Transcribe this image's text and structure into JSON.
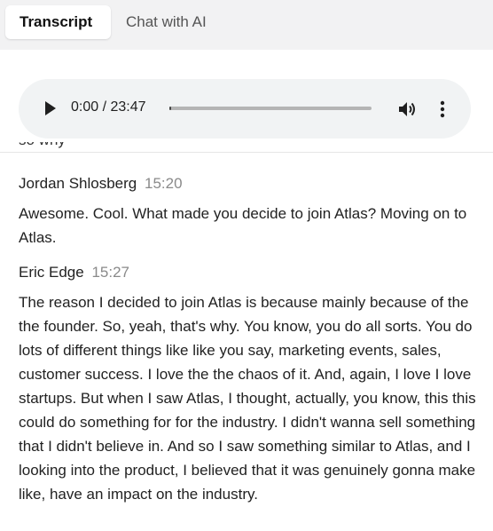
{
  "tabs": [
    {
      "label": "Transcript",
      "active": true
    },
    {
      "label": "Chat with AI",
      "active": false
    }
  ],
  "player": {
    "time_display": "0:00 / 23:47",
    "progress_fraction": 0.0,
    "play_icon": "play-icon",
    "volume_icon": "volume-icon",
    "more_icon": "more-vertical-icon"
  },
  "transcript": {
    "cutoff_text": "so why",
    "entries": [
      {
        "speaker": "Jordan Shlosberg",
        "timestamp": "15:20",
        "text": "Awesome. Cool. What made you decide to join Atlas? Moving on to Atlas."
      },
      {
        "speaker": "Eric Edge",
        "timestamp": "15:27",
        "text": "The reason I decided to join Atlas is because mainly because of the the founder. So, yeah, that's why. You know, you do all sorts. You do lots of different things like like you say, marketing events, sales, customer success. I love the the chaos of it. And, again, I love I love startups. But when I saw Atlas, I thought, actually, you know, this this could do something for for the industry. I didn't wanna sell something that I didn't believe in. And so I saw something similar to Atlas, and I looking into the product, I believed that it was genuinely gonna make like, have an impact on the industry."
      }
    ]
  },
  "colors": {
    "tab_bar_bg": "#f2f2f3",
    "player_bg": "#f1f3f4",
    "timestamp": "#8a8a8a",
    "text": "#222222"
  }
}
